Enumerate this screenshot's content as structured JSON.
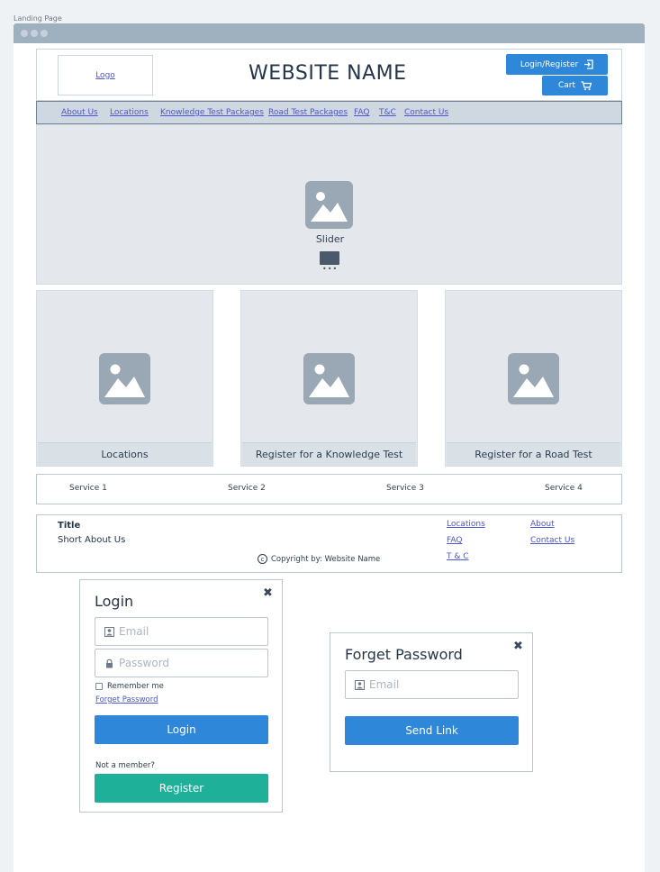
{
  "page_caption": "Landing Page",
  "header": {
    "logo": "Logo",
    "site_name": "WEBSITE NAME",
    "login_register": "Login/Register",
    "cart": "Cart"
  },
  "nav": {
    "items": [
      "About Us",
      "Locations",
      "Knowledge Test Packages",
      "Road Test Packages",
      "FAQ",
      "T&C",
      "Contact Us"
    ]
  },
  "slider": {
    "label": "Slider",
    "dots": "•••"
  },
  "cards": [
    {
      "label": "Locations"
    },
    {
      "label": "Register for a Knowledge Test"
    },
    {
      "label": "Register for a Road Test"
    }
  ],
  "services": [
    "Service 1",
    "Service 2",
    "Service 3",
    "Service 4"
  ],
  "footer": {
    "title": "Title",
    "about": "Short About Us",
    "copyright": "Copyright by: Website Name",
    "links": [
      "Locations",
      "FAQ",
      "T & C",
      "About",
      "Contact Us"
    ]
  },
  "login_modal": {
    "title": "Login",
    "close": "✖",
    "email_placeholder": "Email",
    "password_placeholder": "Password",
    "remember_me": "Remember me",
    "forget_password": "Forget Password",
    "login_button": "Login",
    "not_member": "Not a member?",
    "register_button": "Register"
  },
  "forgot_modal": {
    "title": "Forget Password",
    "close": "✖",
    "email_placeholder": "Email",
    "send_button": "Send Link"
  },
  "colors": {
    "primary_button": "#2f87d9",
    "register_button": "#1fb09a",
    "link": "#4b56d2",
    "placeholder_image": "#9aa8b5"
  }
}
